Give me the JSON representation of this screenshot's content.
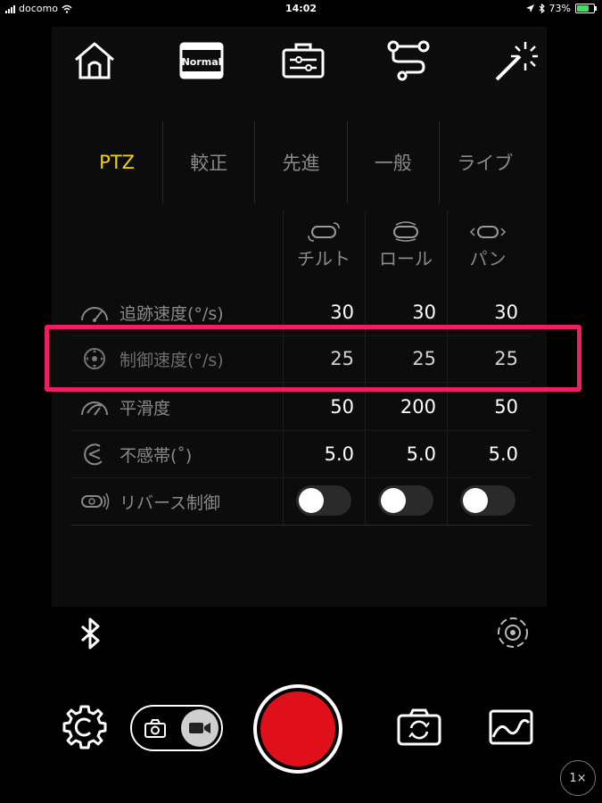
{
  "status_bar": {
    "carrier": "docomo",
    "time": "14:02",
    "battery": "73%"
  },
  "top_toolbar": {
    "icons": [
      "home-icon",
      "normal-mode-icon",
      "toolbox-icon",
      "gimbal-path-icon",
      "magic-wand-icon"
    ],
    "normal_label": "Normal"
  },
  "tabs": [
    {
      "label": "PTZ",
      "active": true
    },
    {
      "label": "較正",
      "active": false
    },
    {
      "label": "先進",
      "active": false
    },
    {
      "label": "一般",
      "active": false
    },
    {
      "label": "ライブ",
      "active": false
    }
  ],
  "axes": [
    {
      "label": "チルト",
      "icon": "tilt-icon"
    },
    {
      "label": "ロール",
      "icon": "roll-icon"
    },
    {
      "label": "パン",
      "icon": "pan-icon"
    }
  ],
  "rows": [
    {
      "label": "追跡速度(°/s)",
      "icon": "speedometer-icon",
      "values": [
        "30",
        "30",
        "30"
      ]
    },
    {
      "label": "制御速度(°/s)",
      "icon": "joystick-icon",
      "values": [
        "25",
        "25",
        "25"
      ]
    },
    {
      "label": "平滑度",
      "icon": "smooth-gauge-icon",
      "values": [
        "50",
        "200",
        "50"
      ]
    },
    {
      "label": "不感帯(˚)",
      "icon": "deadband-icon",
      "values": [
        "5.0",
        "5.0",
        "5.0"
      ]
    }
  ],
  "reverse_row": {
    "label": "リバース制御",
    "icon": "reverse-icon",
    "toggles": [
      false,
      false,
      false
    ]
  },
  "bottom_bar": {
    "zoom": "1×"
  },
  "colors": {
    "accent": "#f3d400",
    "highlight": "#ee1f5f",
    "record": "#e0101a"
  }
}
